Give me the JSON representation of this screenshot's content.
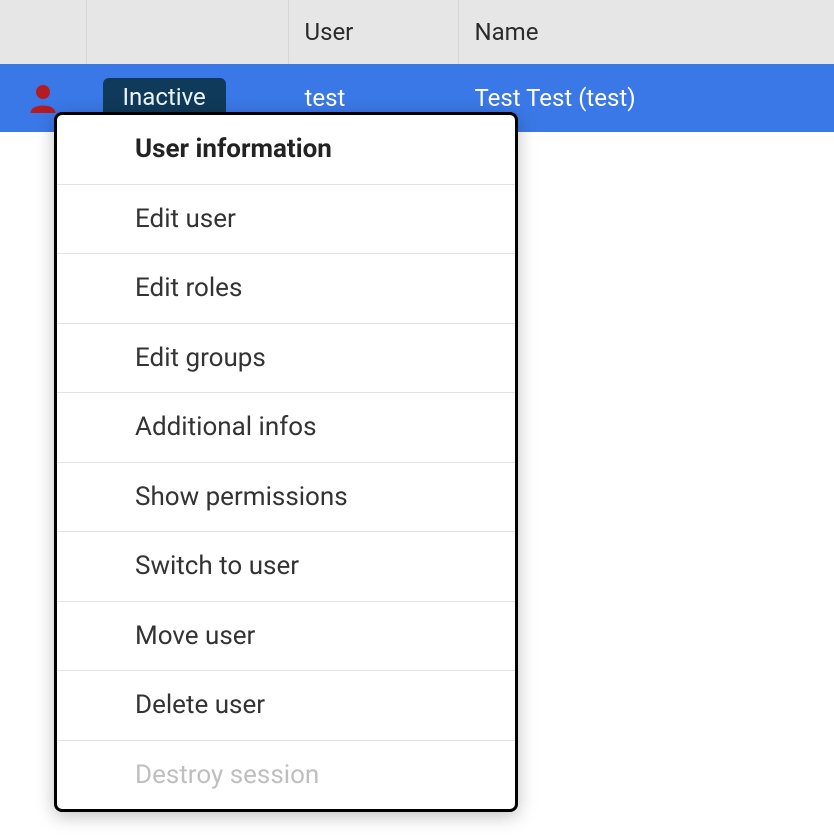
{
  "colors": {
    "rowSelected": "#3b78e7",
    "badgeBg": "#103a5a",
    "userIcon": "#b41b22"
  },
  "table": {
    "headers": {
      "icon": "",
      "status": "",
      "user": "User",
      "name": "Name"
    },
    "rows": [
      {
        "status": "Inactive",
        "user": "test",
        "name": "Test Test (test)"
      }
    ]
  },
  "menu": {
    "items": [
      {
        "label": "User information",
        "type": "header"
      },
      {
        "label": "Edit user",
        "type": "normal"
      },
      {
        "label": "Edit roles",
        "type": "normal"
      },
      {
        "label": "Edit groups",
        "type": "normal"
      },
      {
        "label": "Additional infos",
        "type": "normal"
      },
      {
        "label": "Show permissions",
        "type": "normal"
      },
      {
        "label": "Switch to user",
        "type": "normal"
      },
      {
        "label": "Move user",
        "type": "normal"
      },
      {
        "label": "Delete user",
        "type": "normal"
      },
      {
        "label": "Destroy session",
        "type": "disabled"
      }
    ]
  }
}
